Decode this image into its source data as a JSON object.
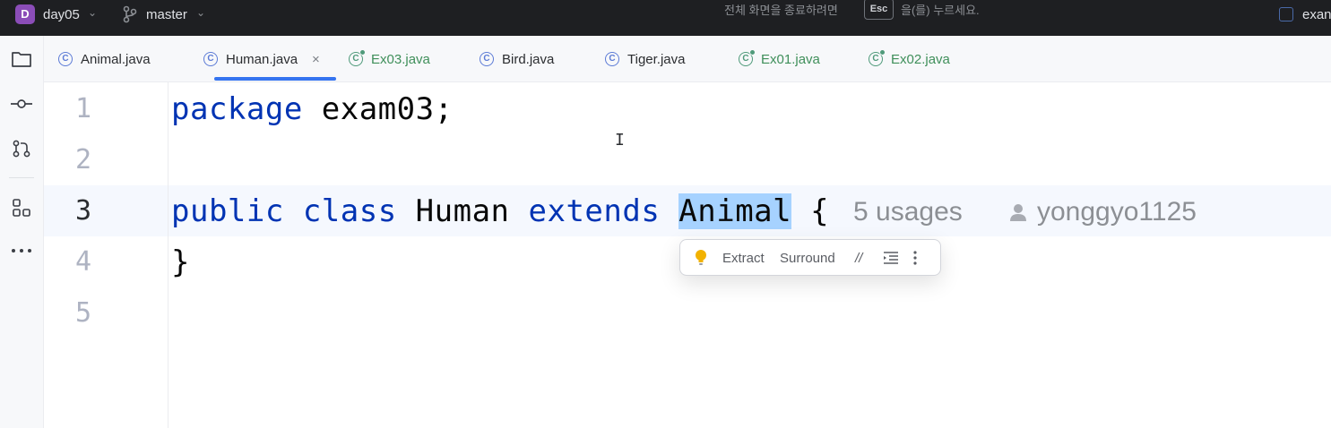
{
  "titlebar": {
    "project_initial": "D",
    "project_name": "day05",
    "branch": "master",
    "fullscreen_note": "전체 화면을 종료하려면",
    "esc_key": "Esc",
    "fullscreen_note_end": "을(를) 누르세요.",
    "right_cut_text": "exan"
  },
  "tabs": [
    {
      "label": "Animal.java",
      "icon": "class-icon"
    },
    {
      "label": "Human.java",
      "icon": "class-icon",
      "active": true,
      "close": "×"
    },
    {
      "label": "Ex03.java",
      "icon": "runnable-class-icon"
    },
    {
      "label": "Bird.java",
      "icon": "class-icon"
    },
    {
      "label": "Tiger.java",
      "icon": "class-icon"
    },
    {
      "label": "Ex01.java",
      "icon": "runnable-class-icon"
    },
    {
      "label": "Ex02.java",
      "icon": "runnable-class-icon"
    }
  ],
  "editor": {
    "line_numbers": [
      "1",
      "2",
      "3",
      "4",
      "5"
    ],
    "current_line": "3",
    "lines": {
      "l1_kw": "package",
      "l1_rest": " exam03;",
      "l3_kw1": "public",
      "l3_kw2": "class",
      "l3_name": "Human",
      "l3_kw3": "extends",
      "l3_selected": "Animal",
      "l3_brace": "{",
      "l4": "}"
    },
    "inlay_usages": "5 usages",
    "inlay_author": "yonggyo1125"
  },
  "floating_toolbar": {
    "extract": "Extract",
    "surround": "Surround",
    "comment_glyph": "//"
  },
  "colors": {
    "keyword": "#0033b3",
    "selection": "#a6d2ff",
    "accent": "#3574f0",
    "titlebar_bg": "#1e1f22"
  }
}
